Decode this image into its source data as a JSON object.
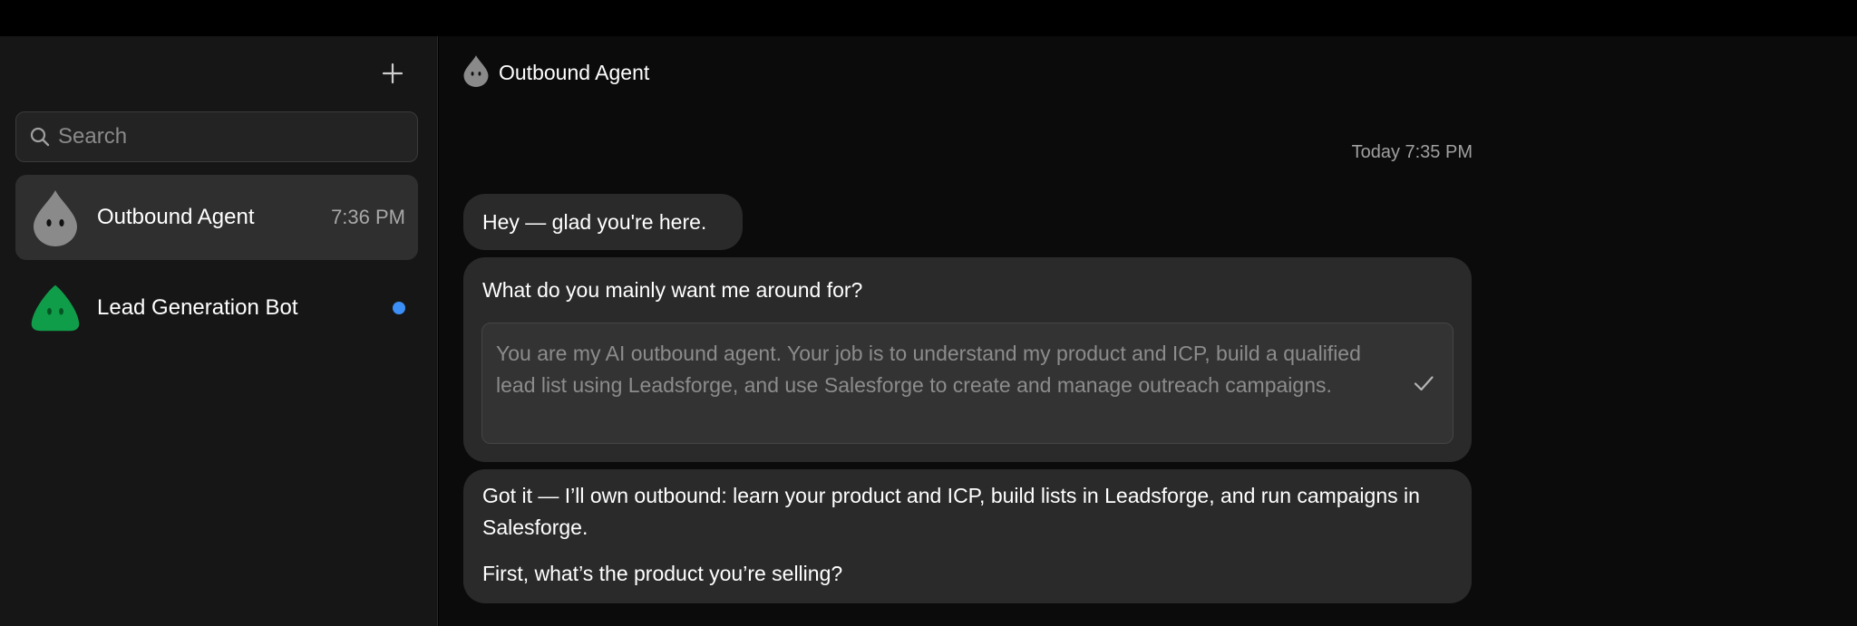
{
  "sidebar": {
    "new_chat_icon": "plus-icon",
    "search": {
      "placeholder": "Search",
      "value": ""
    },
    "conversations": [
      {
        "name": "Outbound Agent",
        "time": "7:36 PM",
        "avatar_color": "#8a8a8a",
        "active": true
      },
      {
        "name": "Lead Generation Bot",
        "unread": true,
        "avatar_color": "#0f9d4a",
        "dot_color": "#3b8ff6"
      }
    ]
  },
  "chat": {
    "title": "Outbound Agent",
    "timestamp": "Today 7:35 PM",
    "messages": [
      {
        "text": "Hey — glad you're here."
      },
      {
        "question": "What do you mainly want me around for?",
        "answer": "You are my AI outbound agent. Your job is to understand my product and ICP, build a qualified lead list using Leadsforge, and use Salesforge to create and manage outreach campaigns."
      },
      {
        "paragraphs": [
          "Got it — I’ll own outbound: learn your product and ICP, build lists in Leadsforge, and run campaigns in Salesforge.",
          "First, what’s the product you’re selling?"
        ]
      }
    ]
  },
  "colors": {
    "accent": "#3b8ff6",
    "brand_green": "#0f9d4a"
  }
}
